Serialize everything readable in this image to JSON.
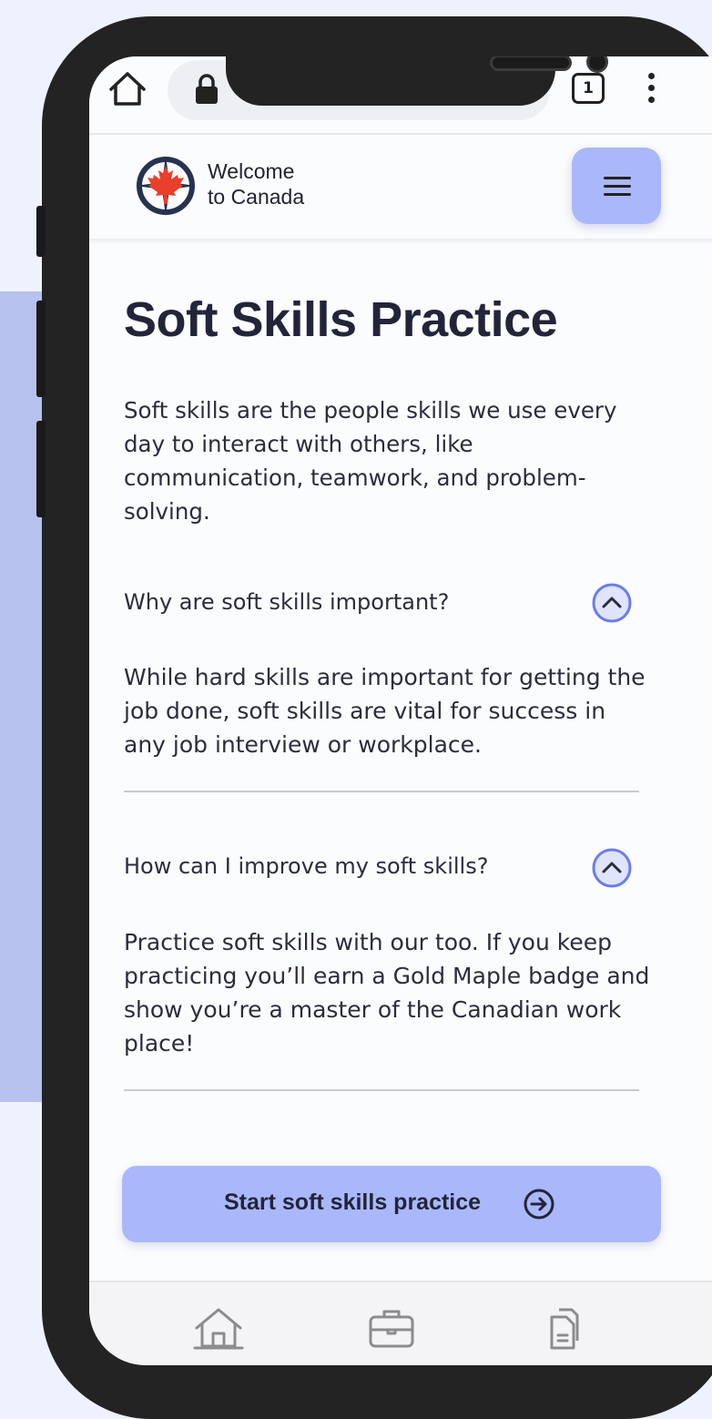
{
  "colors": {
    "accent": "#aab8fb",
    "chevron": "#6b7de8",
    "text": "#22253a",
    "logo_red": "#e8402a"
  },
  "browser": {
    "tab_count": "1",
    "icons": [
      "home-icon",
      "lock-icon",
      "tabs-icon",
      "kebab-menu-icon"
    ]
  },
  "header": {
    "brand_line1": "Welcome",
    "brand_line2": "to Canada",
    "logo": "maple-leaf-compass-logo",
    "menu_icon": "hamburger-icon"
  },
  "main": {
    "title": "Soft Skills Practice",
    "intro": "Soft skills are the people skills we use every day to interact with others, like communication, teamwork, and problem-solving.",
    "faq": [
      {
        "question": "Why are soft skills important?",
        "answer": "While hard skills are important for getting the job done, soft skills are vital for success in any job interview or workplace.",
        "icon": "chevron-up-icon"
      },
      {
        "question": "How can I improve my soft skills?",
        "answer": "Practice soft skills with our too. If you keep practicing you’ll earn a Gold Maple badge and show you’re a master of the Canadian work place!",
        "icon": "chevron-up-icon"
      }
    ],
    "cta_label": "Start soft skills practice",
    "cta_icon": "arrow-right-circle-icon"
  },
  "bottom_nav": {
    "items": [
      "home-icon",
      "briefcase-icon",
      "documents-icon"
    ]
  }
}
